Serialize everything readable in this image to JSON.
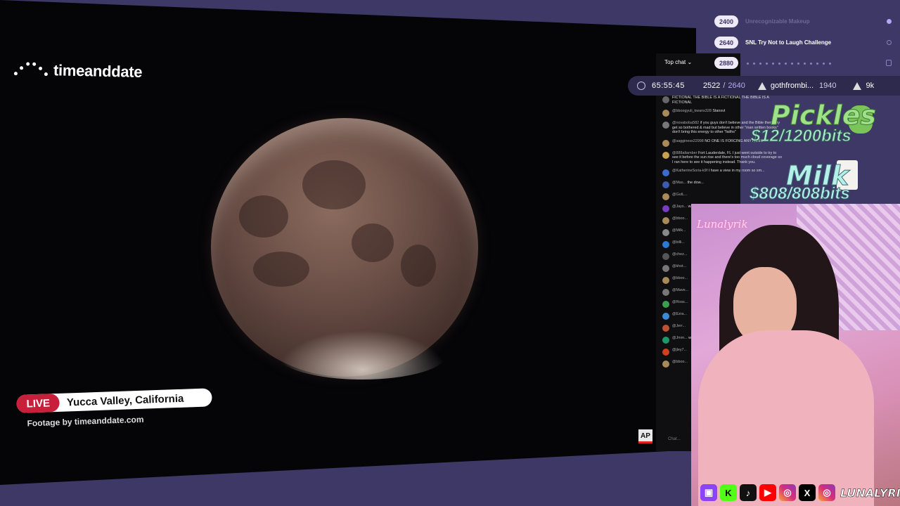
{
  "video": {
    "brand_name": "timeanddate",
    "live_label": "LIVE",
    "location": "Yucca Valley, California",
    "footage_credit": "Footage by timeanddate.com",
    "ap_label": "AP"
  },
  "goals": [
    {
      "value": "2400",
      "label": "Unrecognizable Makeup"
    },
    {
      "value": "2640",
      "label": "SNL Try Not to Laugh Challenge"
    },
    {
      "value": "2880",
      "label": ""
    }
  ],
  "stats": {
    "timer": "65:55:45",
    "current": "2522",
    "separator": "/",
    "goal": "2640",
    "top_user": "gothfrombi...",
    "top_user_bits": "1940",
    "total_bits": "9k"
  },
  "chat": {
    "header": "Top chat",
    "input_placeholder": "Chat...",
    "messages": [
      {
        "user": "",
        "text": "FICTIONAL THE BIBLE IS A FICTIONAL THE BIBLE IS A FICTIONAL",
        "color": "#666"
      },
      {
        "user": "@bboogyuli_kwans328",
        "text": "Stansvt",
        "color": "#a98b5a"
      },
      {
        "user": "@novaboba582",
        "text": "if you guys don't believe and the Bible then why get so bothered & mad but believe in other \"man written books\" don't bring this energy to other \"faiths\"",
        "color": "#777"
      },
      {
        "user": "@sagginess22998",
        "text": "NO ONE IS FORCING ANYTHING",
        "color": "#a98b5a"
      },
      {
        "user": "@888altamber",
        "text": "Fort Lauderdale, FL I just went outside to try to see it before the sun rise and there's too much cloud coverage so I ran here to see it happening instead. Thank you.",
        "color": "#c8a050"
      },
      {
        "user": "@KatherineSoria-k9f",
        "text": "I have a view in my room so sm...",
        "color": "#3b6ad0"
      },
      {
        "user": "@Mas...",
        "text": "the dow...",
        "color": "#3b5bb0"
      },
      {
        "user": "@GutL...",
        "text": "",
        "color": "#a98b5a"
      },
      {
        "user": "@Jays...",
        "text": "want to...",
        "color": "#7a3cc0"
      },
      {
        "user": "@bboo...",
        "text": "",
        "color": "#a98b5a"
      },
      {
        "user": "@Milk...",
        "text": "",
        "color": "#888"
      },
      {
        "user": "@billi...",
        "text": "",
        "color": "#2a7ad8"
      },
      {
        "user": "@chez...",
        "text": "",
        "color": "#555"
      },
      {
        "user": "@khot...",
        "text": "",
        "color": "#777"
      },
      {
        "user": "@bboo...",
        "text": "",
        "color": "#a98b5a"
      },
      {
        "user": "@Mave...",
        "text": "",
        "color": "#777"
      },
      {
        "user": "@Ross...",
        "text": "",
        "color": "#3aa050"
      },
      {
        "user": "@Ezra...",
        "text": "",
        "color": "#3a8ad8"
      },
      {
        "user": "@Jerr...",
        "text": "",
        "color": "#c05030"
      },
      {
        "user": "@Jmm...",
        "text": "what's...",
        "color": "#1a9a6a"
      },
      {
        "user": "@jley7...",
        "text": "",
        "color": "#d04020"
      },
      {
        "user": "@bboo...",
        "text": "",
        "color": "#a98b5a"
      }
    ]
  },
  "overlays": {
    "pickles_title": "Pickles",
    "pickles_amount": "$12/1200bits",
    "milk_title": "Milk",
    "milk_amount": "$808/808bits",
    "cam_sign": "Lunalyrik"
  },
  "socials": {
    "icons": [
      "twitch-icon",
      "kick-icon",
      "tiktok-icon",
      "youtube-icon",
      "instagram-icon",
      "x-icon",
      "instagram-icon"
    ],
    "handle": "LUNALYRIK"
  }
}
